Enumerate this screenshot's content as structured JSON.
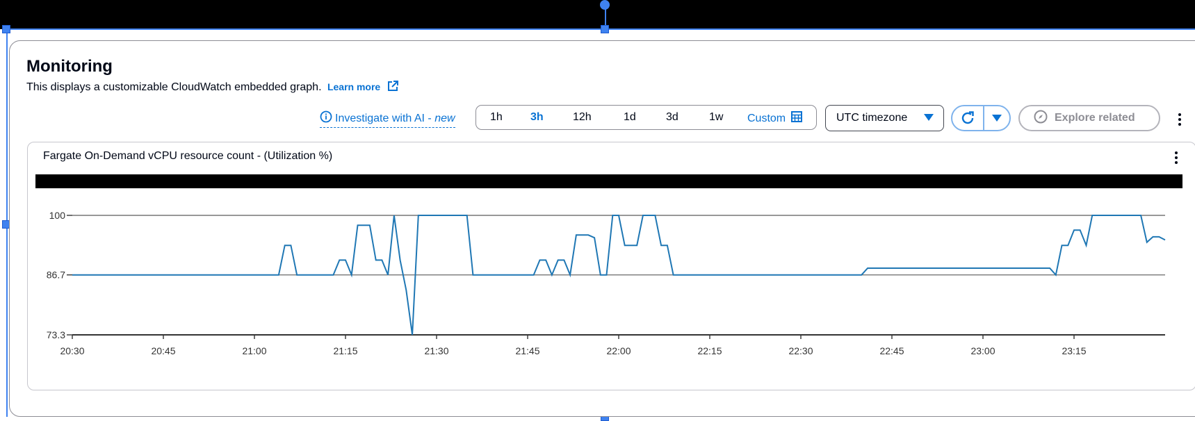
{
  "panel": {
    "title": "Monitoring",
    "description": "This displays a customizable CloudWatch embedded graph.",
    "learn_more": "Learn more"
  },
  "toolbar": {
    "ai_link_label": "Investigate with AI - ",
    "ai_link_new": "new",
    "ranges": [
      {
        "label": "1h",
        "active": false
      },
      {
        "label": "3h",
        "active": true
      },
      {
        "label": "12h",
        "active": false
      },
      {
        "label": "1d",
        "active": false
      },
      {
        "label": "3d",
        "active": false
      },
      {
        "label": "1w",
        "active": false
      }
    ],
    "custom_label": "Custom",
    "timezone_label": "UTC timezone",
    "explore_label": "Explore related"
  },
  "graph": {
    "title": "Fargate On-Demand vCPU resource count - (Utilization %)"
  },
  "icons": {
    "info": "info-circle-icon",
    "calendar": "calendar-icon",
    "refresh": "refresh-icon",
    "caret": "caret-down-icon",
    "compass": "compass-icon",
    "external": "external-link-icon",
    "more": "vertical-dots-icon"
  },
  "colors": {
    "accent": "#0972d3",
    "series": "#1f77b4",
    "selection": "#3f82f0"
  },
  "chart_data": {
    "type": "line",
    "title": "Fargate On-Demand vCPU resource count - (Utilization %)",
    "yticks": [
      "100",
      "86.7",
      "73.3"
    ],
    "ylim": [
      73.3,
      100
    ],
    "xticks": [
      "20:30",
      "20:45",
      "21:00",
      "21:15",
      "21:30",
      "21:45",
      "22:00",
      "22:15",
      "22:30",
      "22:45",
      "23:00",
      "23:15"
    ],
    "grid": "horizontal",
    "series": [
      {
        "points": [
          [
            "20:30",
            86.7
          ],
          [
            "21:04",
            86.7
          ],
          [
            "21:05",
            93.3
          ],
          [
            "21:06",
            93.3
          ],
          [
            "21:07",
            86.7
          ],
          [
            "21:13",
            86.7
          ],
          [
            "21:14",
            90.0
          ],
          [
            "21:15",
            90.0
          ],
          [
            "21:16",
            86.7
          ],
          [
            "21:17",
            97.8
          ],
          [
            "21:19",
            97.8
          ],
          [
            "21:20",
            90.0
          ],
          [
            "21:21",
            90.0
          ],
          [
            "21:22",
            86.7
          ],
          [
            "21:23",
            100
          ],
          [
            "21:24",
            90.0
          ],
          [
            "21:25",
            83.3
          ],
          [
            "21:26",
            73.3
          ],
          [
            "21:27",
            100
          ],
          [
            "21:35",
            100
          ],
          [
            "21:36",
            86.7
          ],
          [
            "21:46",
            86.7
          ],
          [
            "21:47",
            90.0
          ],
          [
            "21:48",
            90.0
          ],
          [
            "21:49",
            86.7
          ],
          [
            "21:50",
            90.0
          ],
          [
            "21:51",
            90.0
          ],
          [
            "21:52",
            86.7
          ],
          [
            "21:53",
            95.6
          ],
          [
            "21:55",
            95.6
          ],
          [
            "21:56",
            95.0
          ],
          [
            "21:57",
            86.7
          ],
          [
            "21:58",
            86.7
          ],
          [
            "21:59",
            100
          ],
          [
            "22:00",
            100
          ],
          [
            "22:01",
            93.3
          ],
          [
            "22:03",
            93.3
          ],
          [
            "22:04",
            100
          ],
          [
            "22:06",
            100
          ],
          [
            "22:07",
            93.3
          ],
          [
            "22:08",
            93.3
          ],
          [
            "22:09",
            86.7
          ],
          [
            "22:40",
            86.7
          ],
          [
            "22:41",
            88.2
          ],
          [
            "23:11",
            88.2
          ],
          [
            "23:12",
            86.7
          ],
          [
            "23:13",
            93.3
          ],
          [
            "23:14",
            93.3
          ],
          [
            "23:15",
            96.7
          ],
          [
            "23:16",
            96.7
          ],
          [
            "23:17",
            93.3
          ],
          [
            "23:18",
            100
          ],
          [
            "23:26",
            100
          ],
          [
            "23:27",
            94.0
          ],
          [
            "23:28",
            95.2
          ],
          [
            "23:29",
            95.2
          ],
          [
            "23:30",
            94.5
          ]
        ]
      }
    ]
  }
}
